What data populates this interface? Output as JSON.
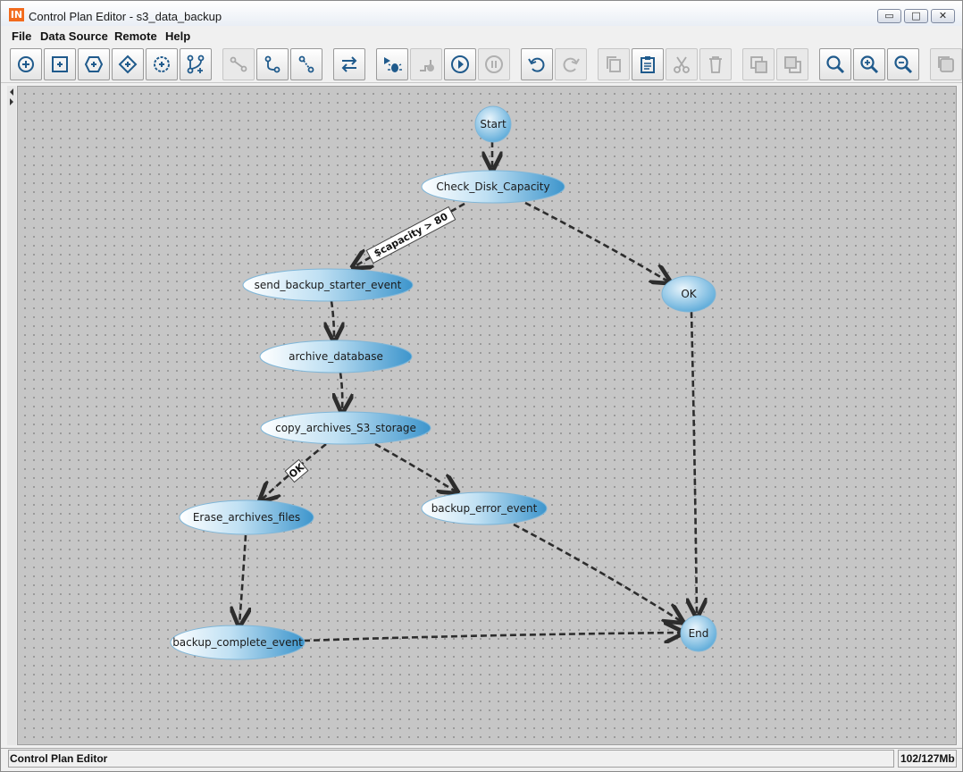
{
  "window": {
    "title": "Control Plan Editor - s3_data_backup",
    "app_icon": "IN"
  },
  "window_buttons": {
    "minimize": "▭",
    "maximize": "□",
    "close": "✕"
  },
  "menu": {
    "file": "File",
    "datasource": "Data Source",
    "remote": "Remote",
    "help": "Help"
  },
  "toolbar": [
    {
      "icon": "add-start-node-icon",
      "enabled": true
    },
    {
      "icon": "add-task-node-icon",
      "enabled": true
    },
    {
      "icon": "add-subplan-node-icon",
      "enabled": true
    },
    {
      "icon": "add-decision-node-icon",
      "enabled": true
    },
    {
      "icon": "add-event-node-icon",
      "enabled": true
    },
    {
      "icon": "add-branch-icon",
      "enabled": true
    },
    {
      "icon": "connect-icon",
      "enabled": false
    },
    {
      "icon": "connect-ok-icon",
      "enabled": true
    },
    {
      "icon": "connect-error-icon",
      "enabled": true
    },
    {
      "icon": "swap-direction-icon",
      "enabled": true
    },
    {
      "icon": "debug-icon",
      "enabled": true
    },
    {
      "icon": "step-icon",
      "enabled": false
    },
    {
      "icon": "run-icon",
      "enabled": true
    },
    {
      "icon": "pause-icon",
      "enabled": false
    },
    {
      "icon": "undo-icon",
      "enabled": true
    },
    {
      "icon": "redo-icon",
      "enabled": false
    },
    {
      "icon": "copy-icon",
      "enabled": false
    },
    {
      "icon": "paste-icon",
      "enabled": true
    },
    {
      "icon": "cut-icon",
      "enabled": false
    },
    {
      "icon": "delete-icon",
      "enabled": false
    },
    {
      "icon": "bring-front-icon",
      "enabled": false
    },
    {
      "icon": "send-back-icon",
      "enabled": false
    },
    {
      "icon": "zoom-fit-icon",
      "enabled": true
    },
    {
      "icon": "zoom-in-icon",
      "enabled": true
    },
    {
      "icon": "zoom-out-icon",
      "enabled": true
    },
    {
      "icon": "export-icon",
      "enabled": false
    }
  ],
  "diagram": {
    "nodes": [
      {
        "id": "start",
        "label": "Start",
        "kind": "terminal"
      },
      {
        "id": "check",
        "label": "Check_Disk_Capacity",
        "kind": "task"
      },
      {
        "id": "send",
        "label": "send_backup_starter_event",
        "kind": "task"
      },
      {
        "id": "ok",
        "label": "OK",
        "kind": "terminal"
      },
      {
        "id": "archive",
        "label": "archive_database",
        "kind": "task"
      },
      {
        "id": "copy",
        "label": "copy_archives_S3_storage",
        "kind": "task"
      },
      {
        "id": "erase",
        "label": "Erase_archives_files",
        "kind": "task"
      },
      {
        "id": "error",
        "label": "backup_error_event",
        "kind": "task"
      },
      {
        "id": "complete",
        "label": "backup_complete_event",
        "kind": "task"
      },
      {
        "id": "end",
        "label": "End",
        "kind": "terminal"
      }
    ],
    "edges": [
      {
        "from": "start",
        "to": "check",
        "label": ""
      },
      {
        "from": "check",
        "to": "send",
        "label": "$capacity > 80"
      },
      {
        "from": "check",
        "to": "ok",
        "label": ""
      },
      {
        "from": "send",
        "to": "archive",
        "label": ""
      },
      {
        "from": "archive",
        "to": "copy",
        "label": ""
      },
      {
        "from": "copy",
        "to": "erase",
        "label": "OK"
      },
      {
        "from": "copy",
        "to": "error",
        "label": ""
      },
      {
        "from": "erase",
        "to": "complete",
        "label": ""
      },
      {
        "from": "ok",
        "to": "end",
        "label": ""
      },
      {
        "from": "error",
        "to": "end",
        "label": ""
      },
      {
        "from": "complete",
        "to": "end",
        "label": ""
      }
    ]
  },
  "status": {
    "left": "Control Plan Editor",
    "memory": "102/127Mb"
  }
}
